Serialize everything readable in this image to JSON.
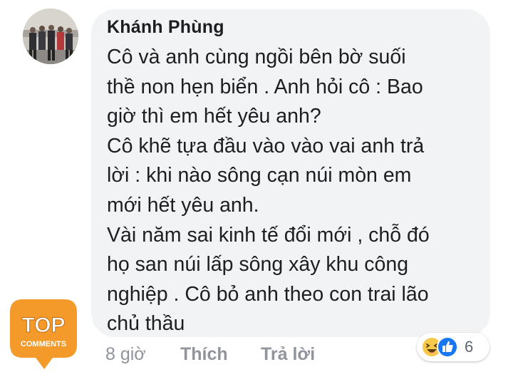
{
  "comment": {
    "author": "Khánh Phùng",
    "lines": [
      "Cô và anh cùng ngồi bên bờ suối",
      "thề non hẹn biển . Anh hỏi cô : Bao",
      "giờ thì em hết yêu anh?",
      "Cô khẽ tựa đầu vào vào vai anh trả",
      "lời : khi nào sông cạn núi mòn em",
      "mới hết yêu anh.",
      "Vài năm sai kinh tế đổi mới , chỗ đó",
      "họ san núi lấp sông xây khu công",
      "nghiệp . Cô bỏ anh theo con trai lão",
      "chủ thầu"
    ]
  },
  "actions": {
    "time": "8 giờ",
    "like_label": "Thích",
    "reply_label": "Trả lời"
  },
  "reactions": {
    "icons": [
      "haha-icon",
      "like-icon"
    ],
    "count": "6"
  },
  "badge": {
    "title": "TOP",
    "subtitle": "COMMENTS"
  },
  "colors": {
    "bubble": "#f2f3f5",
    "text": "#1c1e21",
    "meta": "#90949c",
    "badge_orange": "#f39a2b",
    "like_blue": "#1877f2",
    "haha_yellow": "#f7c94a"
  }
}
